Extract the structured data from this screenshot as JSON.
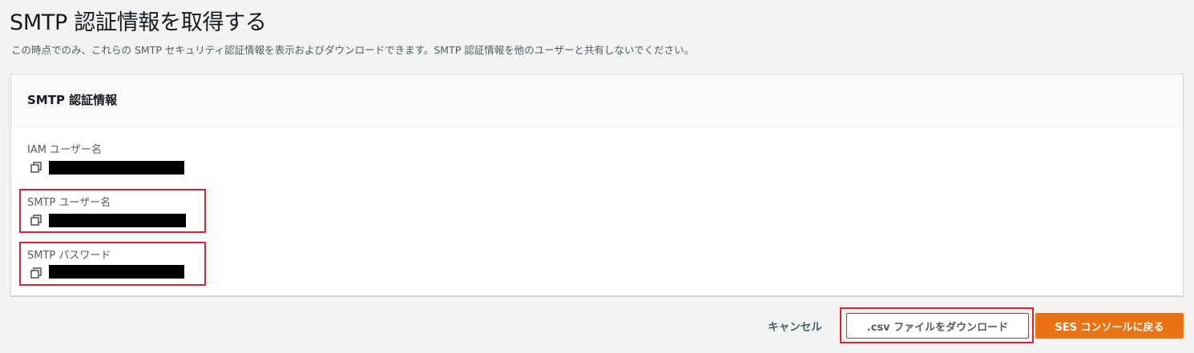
{
  "page": {
    "title": "SMTP 認証情報を取得する",
    "description": "この時点でのみ、これらの SMTP セキュリティ認証情報を表示およびダウンロードできます。SMTP 認証情報を他のユーザーと共有しないでください。"
  },
  "panel": {
    "title": "SMTP 認証情報",
    "fields": [
      {
        "label": "IAM ユーザー名",
        "value_redacted": true,
        "icon": "copy-icon"
      },
      {
        "label": "SMTP ユーザー名",
        "value_redacted": true,
        "icon": "copy-icon",
        "highlighted": true
      },
      {
        "label": "SMTP パスワード",
        "value_redacted": true,
        "icon": "copy-icon",
        "highlighted": true
      }
    ]
  },
  "actions": {
    "cancel_label": "キャンセル",
    "download_label": ".csv ファイルをダウンロード",
    "primary_label": "SES コンソールに戻る"
  },
  "colors": {
    "accent": "#ec7211",
    "highlight_border": "#d9232e",
    "redaction": "#000000"
  }
}
